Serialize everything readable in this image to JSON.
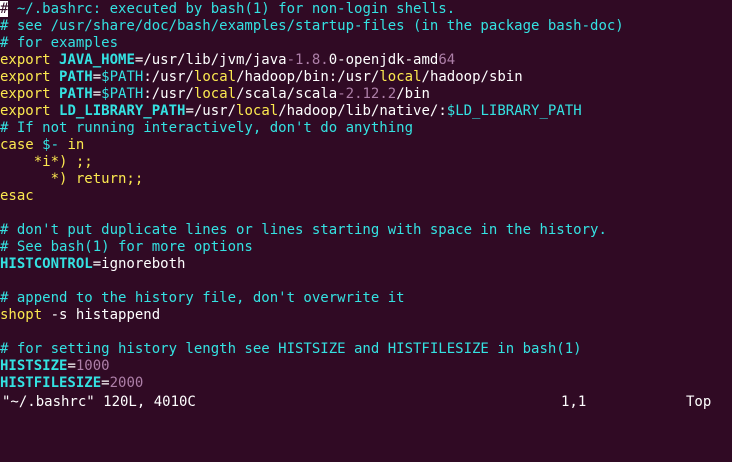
{
  "colors": {
    "background": "#300a24",
    "comment": "#34e2e2",
    "keyword": "#fce94f",
    "variable": "#34e2e2",
    "string": "#ad7fa8",
    "text": "#ffffff",
    "number": "#ad7fa8"
  },
  "lines": [
    [
      [
        "cursor",
        "#"
      ],
      [
        "comment",
        " ~/.bashrc: executed by bash(1) for non-login shells."
      ]
    ],
    [
      [
        "comment",
        "# see /usr/share/doc/bash/examples/startup-files (in the package bash-doc)"
      ]
    ],
    [
      [
        "comment",
        "# for examples"
      ]
    ],
    [
      [
        "keyword",
        "export "
      ],
      [
        "var",
        "JAVA_HOME"
      ],
      [
        "text",
        "=/usr/lib/jvm/java"
      ],
      [
        "num",
        "-1.8."
      ],
      [
        "text",
        "0-openjdk-amd"
      ],
      [
        "num",
        "64"
      ]
    ],
    [
      [
        "keyword",
        "export "
      ],
      [
        "var",
        "PATH"
      ],
      [
        "text",
        "="
      ],
      [
        "varref",
        "$PATH"
      ],
      [
        "text",
        ":/usr/"
      ],
      [
        "keyword",
        "local"
      ],
      [
        "text",
        "/hadoop/bin:/usr/"
      ],
      [
        "keyword",
        "local"
      ],
      [
        "text",
        "/hadoop/sbin"
      ]
    ],
    [
      [
        "keyword",
        "export "
      ],
      [
        "var",
        "PATH"
      ],
      [
        "text",
        "="
      ],
      [
        "varref",
        "$PATH"
      ],
      [
        "text",
        ":/usr/"
      ],
      [
        "keyword",
        "local"
      ],
      [
        "text",
        "/scala/scala"
      ],
      [
        "num",
        "-2.12.2"
      ],
      [
        "text",
        "/bin"
      ]
    ],
    [
      [
        "keyword",
        "export "
      ],
      [
        "var",
        "LD_LIBRARY_PATH"
      ],
      [
        "text",
        "=/usr/"
      ],
      [
        "keyword",
        "local"
      ],
      [
        "text",
        "/hadoop/lib/native/:"
      ],
      [
        "varref",
        "$LD_LIBRARY_PATH"
      ]
    ],
    [
      [
        "comment",
        "# If not running interactively, don't do anything"
      ]
    ],
    [
      [
        "keyword",
        "case "
      ],
      [
        "varref",
        "$-"
      ],
      [
        "keyword",
        " in"
      ]
    ],
    [
      [
        "text",
        "    "
      ],
      [
        "keyword",
        "*i*) ;;"
      ]
    ],
    [
      [
        "text",
        "      "
      ],
      [
        "keyword",
        "*) return;;"
      ]
    ],
    [
      [
        "keyword",
        "esac"
      ]
    ],
    [],
    [
      [
        "comment",
        "# don't put duplicate lines or lines starting with space in the history."
      ]
    ],
    [
      [
        "comment",
        "# See bash(1) for more options"
      ]
    ],
    [
      [
        "var",
        "HISTCONTROL"
      ],
      [
        "text",
        "=ignoreboth"
      ]
    ],
    [],
    [
      [
        "comment",
        "# append to the history file, don't overwrite it"
      ]
    ],
    [
      [
        "keyword",
        "shopt"
      ],
      [
        "text",
        " -s histappend"
      ]
    ],
    [],
    [
      [
        "comment",
        "# for setting history length see HISTSIZE and HISTFILESIZE in bash(1)"
      ]
    ],
    [
      [
        "var",
        "HISTSIZE"
      ],
      [
        "text",
        "="
      ],
      [
        "num",
        "1000"
      ]
    ],
    [
      [
        "var",
        "HISTFILESIZE"
      ],
      [
        "text",
        "="
      ],
      [
        "num",
        "2000"
      ]
    ]
  ],
  "status": {
    "file_info": "\"~/.bashrc\" 120L, 4010C",
    "position": "1,1",
    "scroll": "Top"
  }
}
